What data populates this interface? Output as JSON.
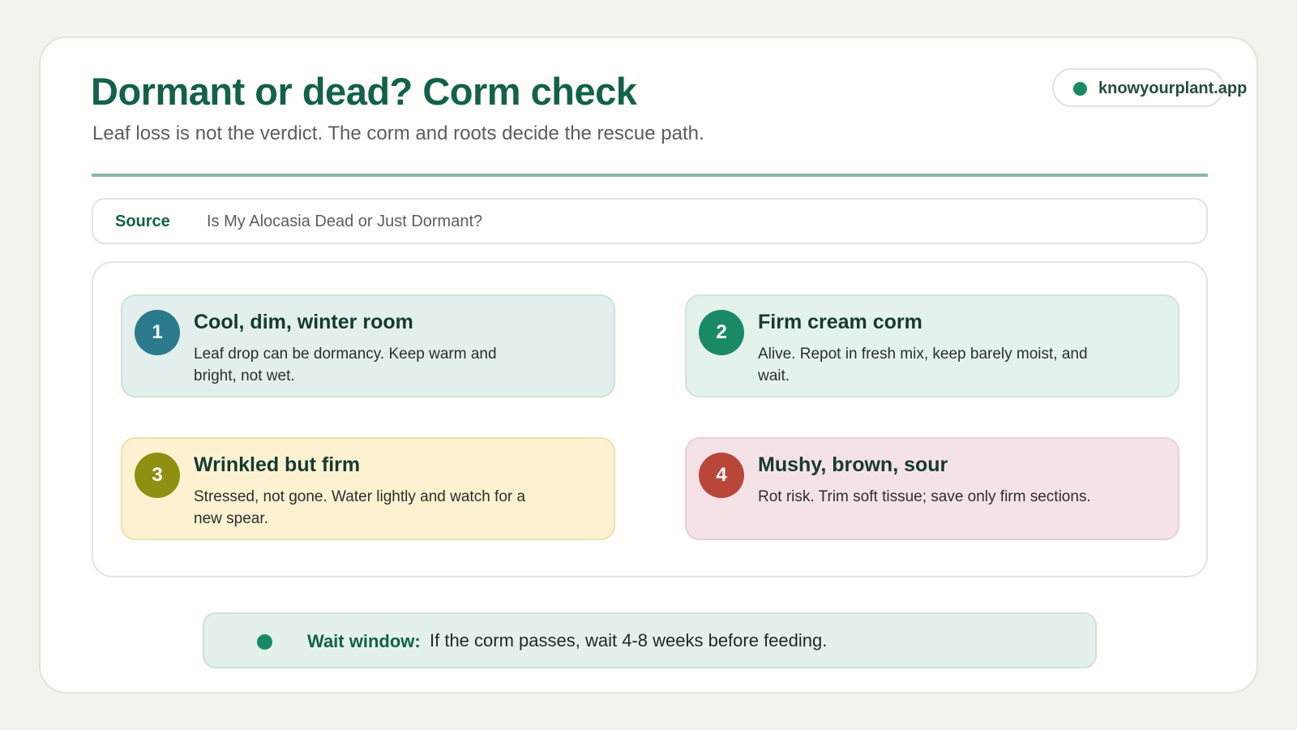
{
  "header": {
    "title": "Dormant or dead? Corm check",
    "subtitle": "Leaf loss is not the verdict. The corm and roots decide the rescue path."
  },
  "brand": {
    "label": "knowyourplant.app",
    "dot_color": "#1a8a66"
  },
  "source": {
    "label": "Source",
    "text": "Is My Alocasia Dead or Just Dormant?"
  },
  "steps": [
    {
      "number": "1",
      "title": "Cool, dim, winter room",
      "description": "Leaf drop can be dormancy. Keep warm and bright, not wet.",
      "badge_color": "#2a7a8c"
    },
    {
      "number": "2",
      "title": "Firm cream corm",
      "description": "Alive. Repot in fresh mix, keep barely moist, and wait.",
      "badge_color": "#1a8a66"
    },
    {
      "number": "3",
      "title": "Wrinkled but firm",
      "description": "Stressed, not gone. Water lightly and watch for a new spear.",
      "badge_color": "#8f8f12"
    },
    {
      "number": "4",
      "title": "Mushy, brown, sour",
      "description": "Rot risk. Trim soft tissue; save only firm sections.",
      "badge_color": "#b8473a"
    }
  ],
  "wait": {
    "label": "Wait window:",
    "text": "If the corm passes, wait 4-8 weeks before feeding."
  },
  "colors": {
    "accent": "#13614a",
    "background": "#f4f2ec"
  }
}
